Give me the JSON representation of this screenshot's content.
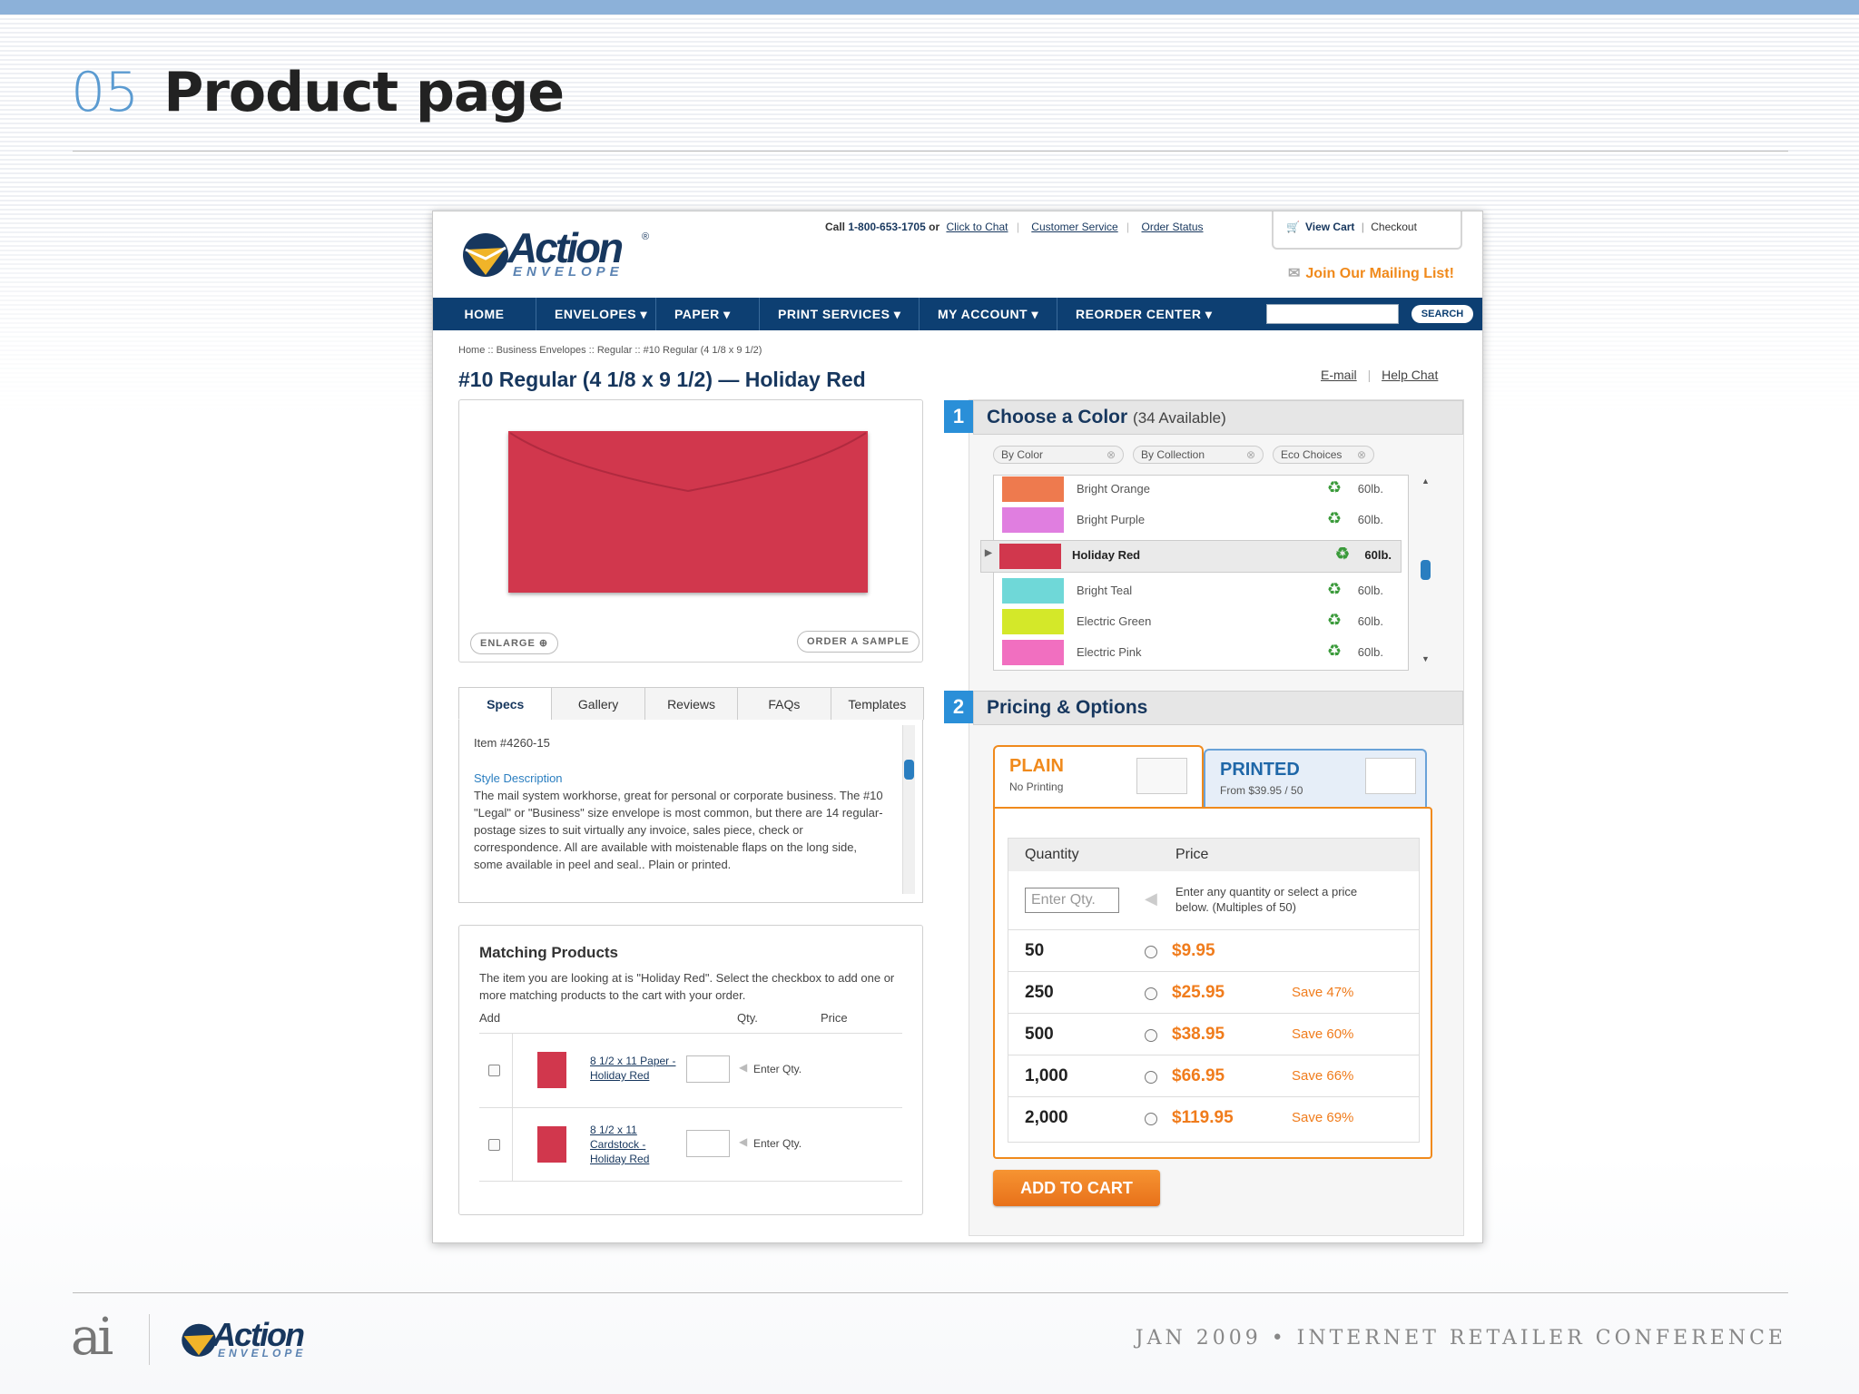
{
  "slide": {
    "number": "05",
    "title": "Product page",
    "footer": "JAN 2009 • INTERNET RETAILER CONFERENCE",
    "ai_logo": "ai",
    "footer_logo": {
      "brand": "Action",
      "sub": "ENVELOPE"
    }
  },
  "header": {
    "logo_brand": "Action",
    "logo_sub": "ENVELOPE",
    "call_label": "Call",
    "phone": "1-800-653-1705",
    "or": "or",
    "click_to_chat": "Click to Chat",
    "customer_service": "Customer Service",
    "order_status": "Order Status",
    "view_cart": "View Cart",
    "checkout": "Checkout",
    "join_mailing": "Join Our Mailing List!"
  },
  "nav": {
    "items": [
      "HOME",
      "ENVELOPES ▾",
      "PAPER ▾",
      "PRINT SERVICES ▾",
      "MY ACCOUNT ▾",
      "REORDER CENTER ▾"
    ],
    "search_button": "SEARCH"
  },
  "product": {
    "breadcrumb": "Home :: Business Envelopes :: Regular :: #10 Regular (4 1/8 x 9 1/2)",
    "title": "#10 Regular (4 1/8 x 9 1/2) — Holiday Red",
    "email_link": "E-mail",
    "help_chat_link": "Help Chat",
    "enlarge": "ENLARGE",
    "order_sample": "ORDER A SAMPLE",
    "envelope_color": "#d1374d"
  },
  "tabs": [
    "Specs",
    "Gallery",
    "Reviews",
    "FAQs",
    "Templates"
  ],
  "specs": {
    "item": "Item #4260-15",
    "style_heading": "Style Description",
    "description": "The mail system workhorse, great for personal or corporate business. The #10 \"Legal\" or \"Business\" size envelope is most common, but there are 14 regular-postage sizes to suit virtually any invoice, sales piece, check or correspondence. All are available with moistenable flaps on the long side, some available in peel and seal.. Plain or printed."
  },
  "matching": {
    "heading": "Matching Products",
    "intro": "The item you are looking at is \"Holiday Red\". Select the checkbox to add one or more matching products to the cart with your order.",
    "col_add": "Add",
    "col_qty": "Qty.",
    "col_price": "Price",
    "rows": [
      {
        "name": "8 1/2 x 11 Paper - Holiday Red",
        "price_hint": "Enter Qty."
      },
      {
        "name": "8 1/2 x 11 Cardstock - Holiday Red",
        "price_hint": "Enter Qty."
      }
    ]
  },
  "color_section": {
    "step": "1",
    "title": "Choose a Color",
    "count": "(34 Available)",
    "filters": [
      "By Color",
      "By Collection",
      "Eco Choices"
    ],
    "colors": [
      {
        "name": "Bright Orange",
        "weight": "60lb.",
        "hex": "#ee7a4e"
      },
      {
        "name": "Bright Purple",
        "weight": "60lb.",
        "hex": "#e07ee0"
      },
      {
        "name": "Holiday Red",
        "weight": "60lb.",
        "hex": "#d1374d"
      },
      {
        "name": "Bright Teal",
        "weight": "60lb.",
        "hex": "#6fd8d8"
      },
      {
        "name": "Electric Green",
        "weight": "60lb.",
        "hex": "#d4e829"
      },
      {
        "name": "Electric Pink",
        "weight": "60lb.",
        "hex": "#f16fc0"
      }
    ],
    "selected": "Holiday Red"
  },
  "pricing_section": {
    "step": "2",
    "title": "Pricing & Options",
    "plain_title": "PLAIN",
    "plain_sub": "No Printing",
    "printed_title": "PRINTED",
    "printed_sub": "From $39.95 / 50",
    "col_quantity": "Quantity",
    "col_price": "Price",
    "qty_placeholder": "Enter Qty.",
    "qty_hint": "Enter any quantity or select a price below. (Multiples of 50)",
    "rows": [
      {
        "qty": "50",
        "price": "$9.95",
        "save": ""
      },
      {
        "qty": "250",
        "price": "$25.95",
        "save": "Save 47%"
      },
      {
        "qty": "500",
        "price": "$38.95",
        "save": "Save 60%"
      },
      {
        "qty": "1,000",
        "price": "$66.95",
        "save": "Save 66%"
      },
      {
        "qty": "2,000",
        "price": "$119.95",
        "save": "Save 69%"
      }
    ],
    "add_to_cart": "ADD TO CART"
  }
}
